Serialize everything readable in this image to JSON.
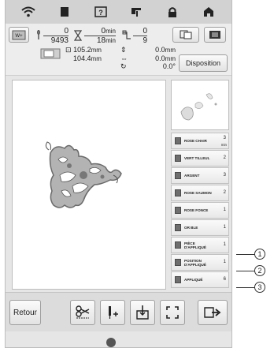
{
  "top_icons": [
    "wifi-icon",
    "document-icon",
    "help-icon",
    "threading-icon",
    "lock-icon",
    "home-icon"
  ],
  "info": {
    "stitch_current": "0",
    "stitch_total": "9493",
    "time_elapsed": "0",
    "time_total": "18",
    "time_unit": "min",
    "color_current": "0",
    "color_total": "9",
    "size_height": "105.2",
    "size_width": "104.4",
    "size_unit": "mm",
    "offset_vertical": "0.0",
    "offset_horizontal": "0.0",
    "offset_unit": "mm",
    "rotation": "0.0°"
  },
  "disposition_label": "Disposition",
  "color_list": [
    {
      "name": "ROSE CHAIR",
      "count": "3",
      "suffix": "min"
    },
    {
      "name": "VERT TILLEUL",
      "count": "2"
    },
    {
      "name": "ARGENT",
      "count": "3"
    },
    {
      "name": "ROSE SAUMON",
      "count": "2"
    },
    {
      "name": "ROSE FONCE",
      "count": "1"
    },
    {
      "name": "OR BLE",
      "count": "1"
    },
    {
      "name": "PIÈCE\nD'APPLIQUÉ",
      "count": "1"
    },
    {
      "name": "POSITION\nD'APPLIQUÉ",
      "count": "1"
    },
    {
      "name": "APPLIQUÉ",
      "count": "6"
    }
  ],
  "callouts": [
    "1",
    "2",
    "3"
  ],
  "bottom": {
    "return_label": "Retour",
    "icons": [
      "cut-icon",
      "needle-position-icon",
      "start-point-icon",
      "trial-icon",
      "next-icon"
    ]
  }
}
